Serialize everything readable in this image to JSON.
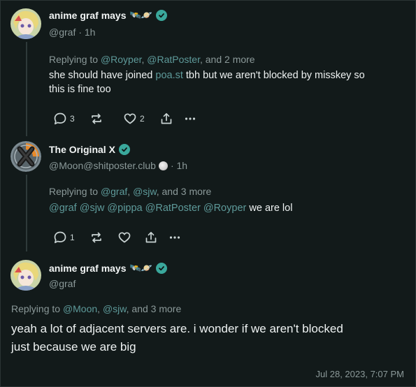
{
  "posts": [
    {
      "display_name": "anime graf mays",
      "name_emojis": "🛰️🪐",
      "handle": "@graf",
      "time": "· 1h",
      "reply_prefix": "Replying to",
      "reply_m1": "@Royper",
      "reply_sep1": ",",
      "reply_m2": "@RatPoster",
      "reply_more": ", and 2 more",
      "text_a": "she should have joined",
      "text_link": "poa.st",
      "text_b": "tbh but we aren't blocked by misskey so",
      "text_c": "this is fine too",
      "replies": "3",
      "likes": "2"
    },
    {
      "display_name": "The Original X",
      "handle": "@Moon@shitposter.club",
      "time": "· 1h",
      "reply_prefix": "Replying to",
      "reply_m1": "@graf",
      "reply_sep1": ",",
      "reply_m2": "@sjw",
      "reply_more": ", and 3 more",
      "mentions": "@graf @sjw @pippa @RatPoster @Royper",
      "text": "we are lol",
      "replies": "1"
    },
    {
      "display_name": "anime graf mays",
      "name_emojis": "🛰️🪐",
      "handle": "@graf",
      "reply_prefix": "Replying to",
      "reply_m1": "@Moon",
      "reply_sep1": ",",
      "reply_m2": "@sjw",
      "reply_more": ", and 3 more",
      "text_line1": "yeah a lot of adjacent servers are. i wonder if we aren't blocked",
      "text_line2": "just because we are big",
      "timestamp": "Jul 28, 2023, 7:07 PM"
    }
  ],
  "colors": {
    "background": "#121a1a",
    "accent": "#5e9a9a",
    "verified": "#3aa89c",
    "muted": "#8b9999"
  },
  "icons": [
    "reply-icon",
    "boost-icon",
    "heart-icon",
    "share-icon",
    "more-icon",
    "verified-icon"
  ]
}
